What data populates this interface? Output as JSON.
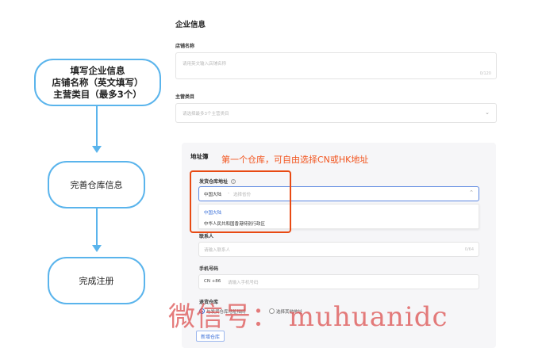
{
  "flowchart": {
    "step1": [
      "填写企业信息",
      "店铺名称（英文填写）",
      "主营类目（最多3个）"
    ],
    "step2": "完善仓库信息",
    "step3": "完成注册"
  },
  "form": {
    "title": "企业信息",
    "store_name": {
      "label": "店铺名称",
      "placeholder": "请用英文输入店铺名称",
      "counter": "0/120"
    },
    "category": {
      "label": "主营类目",
      "placeholder": "请选择最多3个主营类目"
    }
  },
  "address": {
    "title": "地址簿",
    "annotation": "第一个仓库，可自由选择CN或HK地址",
    "warehouse": {
      "label": "发货仓库地址",
      "selected": "中国大陆",
      "placeholder": "选择省份",
      "options": [
        "中国大陆",
        "中华人民共和国香港特别行政区"
      ]
    },
    "contact": {
      "label": "联系人",
      "placeholder": "请输入联系人",
      "counter": "0/64"
    },
    "phone": {
      "label": "手机号码",
      "prefix": "CN +86",
      "placeholder": "请输入手机号码"
    },
    "return": {
      "label": "退货仓库",
      "option1": "与发货仓库地址相同",
      "option2": "选择其他地址"
    },
    "add_button": "新增仓库"
  },
  "watermark": "微信号： muhuanidc",
  "colors": {
    "flow_border": "#5ab4ec",
    "annotation": "#f2551f",
    "red_box": "#e84a13"
  }
}
